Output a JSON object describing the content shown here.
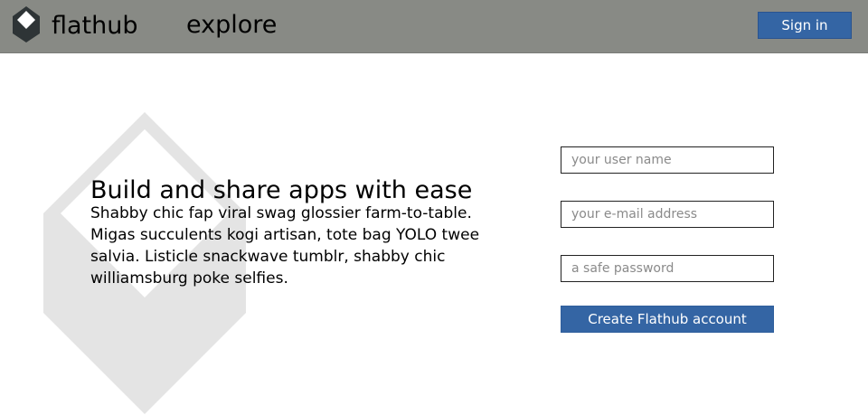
{
  "header": {
    "brand": "flathub",
    "nav_explore": "explore",
    "signin_label": "Sign in",
    "logo_icon": "flathub-logo-icon",
    "background_color": "#888a85"
  },
  "hero": {
    "headline": "Build and share apps with ease",
    "blurb": "Shabby chic fap viral swag glossier farm-to-table. Migas succulents kogi artisan, tote bag YOLO twee salvia. Listicle snackwave tumblr, shabby chic williamsburg poke selfies."
  },
  "signup": {
    "username_placeholder": "your user name",
    "email_placeholder": "your e-mail address",
    "password_placeholder": "a safe password",
    "username_value": "",
    "email_value": "",
    "password_value": "",
    "create_label": "Create Flathub account"
  },
  "colors": {
    "accent": "#3465a4",
    "watermark": "#e4e4e4"
  }
}
